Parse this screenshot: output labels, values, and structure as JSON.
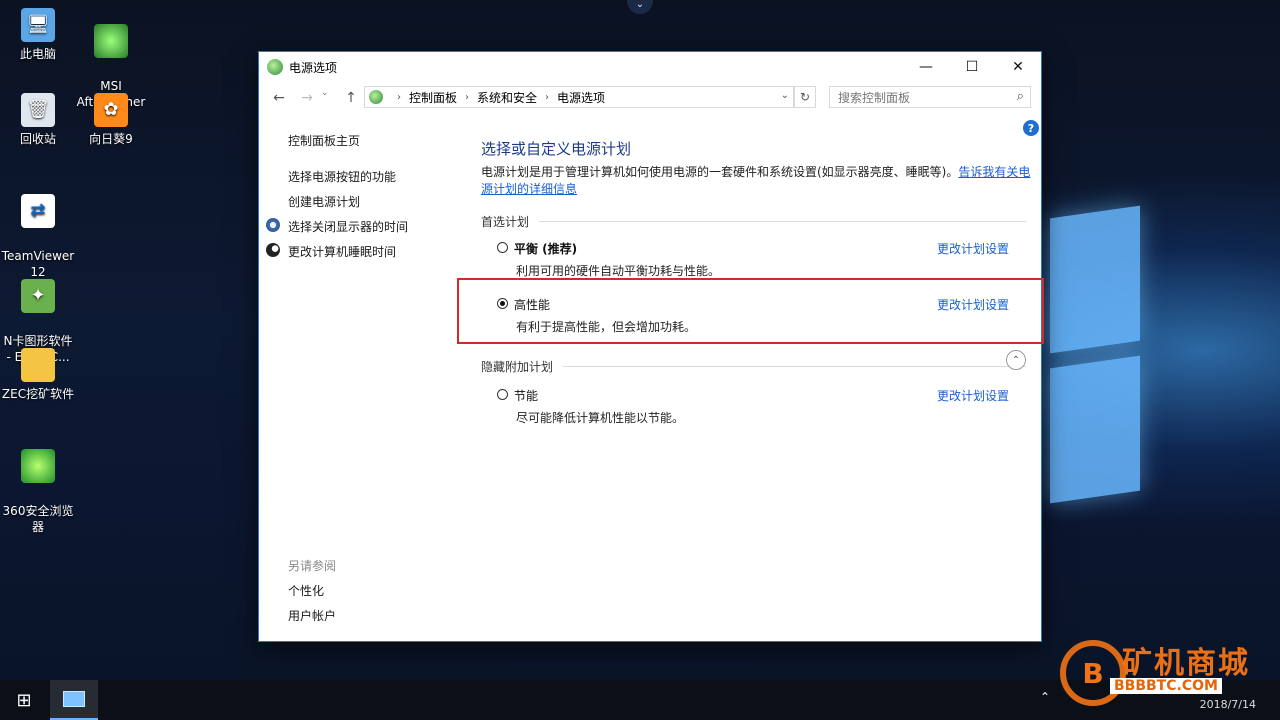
{
  "desktop": {
    "icons": [
      {
        "label": "此电脑"
      },
      {
        "label": "MSI\nAfterburner"
      },
      {
        "label": "回收站"
      },
      {
        "label": "向日葵9"
      },
      {
        "label": "TeamViewer\n12"
      },
      {
        "label": "N卡图形软件\n- ETH.SC..."
      },
      {
        "label": "ZEC挖矿软件"
      },
      {
        "label": "360安全浏览\n器"
      }
    ]
  },
  "window": {
    "title": "电源选项",
    "controls": {
      "minimize": "—",
      "maximize": "☐",
      "close": "✕"
    },
    "breadcrumb": [
      "控制面板",
      "系统和安全",
      "电源选项"
    ],
    "search_placeholder": "搜索控制面板"
  },
  "sidebar": {
    "home": "控制面板主页",
    "links": [
      "选择电源按钮的功能",
      "创建电源计划",
      "选择关闭显示器的时间",
      "更改计算机睡眠时间"
    ],
    "see_also_title": "另请参阅",
    "see_also": [
      "个性化",
      "用户帐户"
    ]
  },
  "main": {
    "title": "选择或自定义电源计划",
    "description": "电源计划是用于管理计算机如何使用电源的一套硬件和系统设置(如显示器亮度、睡眠等)。",
    "description_link": "告诉我有关电源计划的详细信息",
    "preferred_header": "首选计划",
    "hidden_header": "隐藏附加计划",
    "change_link": "更改计划设置",
    "plans": [
      {
        "name": "平衡 (推荐)",
        "desc": "利用可用的硬件自动平衡功耗与性能。",
        "selected": false
      },
      {
        "name": "高性能",
        "desc": "有利于提高性能，但会增加功耗。",
        "selected": true
      },
      {
        "name": "节能",
        "desc": "尽可能降低计算机性能以节能。",
        "selected": false
      }
    ]
  },
  "taskbar": {
    "clock": "2018/7/14"
  },
  "watermark": {
    "logo_letter": "B",
    "text": "矿机商城",
    "url": "BBBBTC.COM"
  },
  "colors": {
    "accent_link": "#1a5fd0",
    "title_blue": "#1e3a8a",
    "highlight_red": "#d62828"
  }
}
